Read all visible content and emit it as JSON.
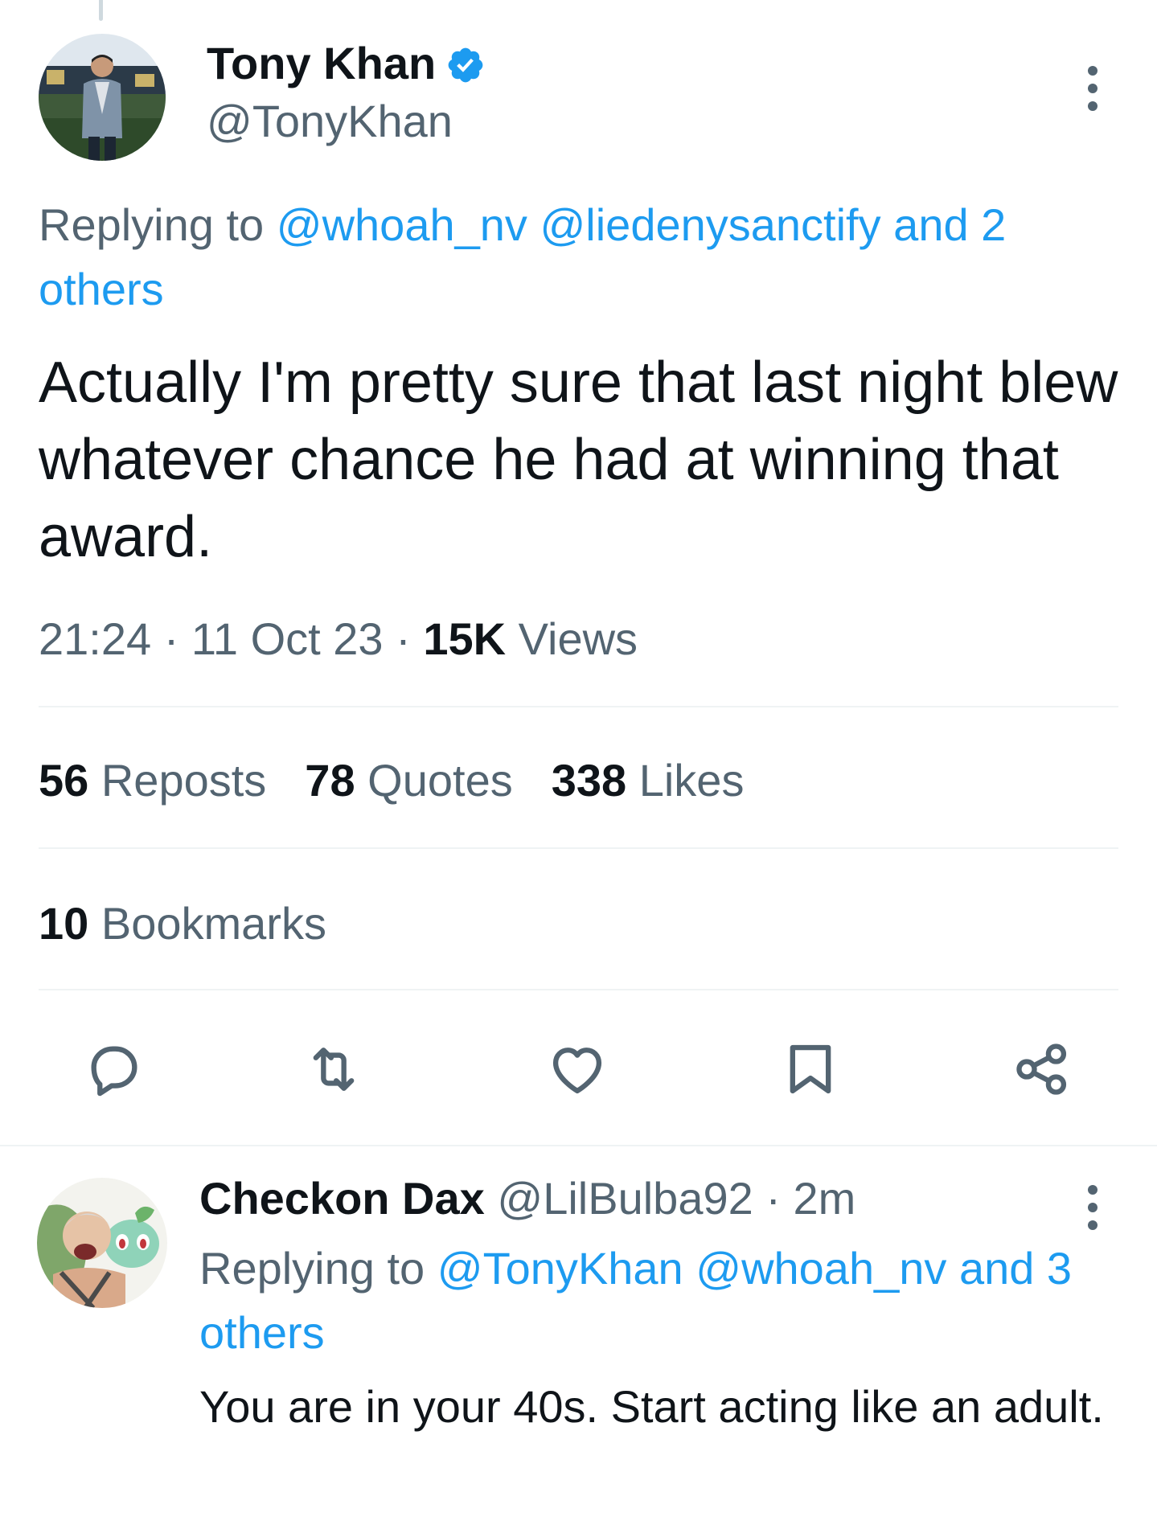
{
  "main_tweet": {
    "author_name": "Tony Khan",
    "author_handle": "@TonyKhan",
    "replying_prefix": "Replying to ",
    "replying_mention_1": "@whoah_nv",
    "replying_mention_2": "@liedenysanctify",
    "replying_others": "and 2 others",
    "text": "Actually I'm pretty sure that last night blew whatever chance he had at winning that award.",
    "time": "21:24",
    "date": "11 Oct 23",
    "separator": "·",
    "views_count": "15K",
    "views_label": "Views",
    "reposts_count": "56",
    "reposts_label": "Reposts",
    "quotes_count": "78",
    "quotes_label": "Quotes",
    "likes_count": "338",
    "likes_label": "Likes",
    "bookmarks_count": "10",
    "bookmarks_label": "Bookmarks"
  },
  "actions": {
    "icons": [
      "comment-icon",
      "retweet-icon",
      "heart-icon",
      "bookmark-icon",
      "share-icon"
    ]
  },
  "reply_tweet": {
    "author_name": "Checkon Dax",
    "author_handle": "@LilBulba92",
    "separator": "·",
    "time_ago": "2m",
    "replying_prefix": "Replying to ",
    "replying_mention_1": "@TonyKhan",
    "replying_mention_2": "@whoah_nv",
    "replying_others": "and 3 others",
    "text": "You are in your 40s. Start acting like an adult."
  },
  "colors": {
    "accent": "#1d9bf0",
    "secondary_text": "#536471",
    "primary_text": "#0f1419",
    "divider": "#eff3f4"
  }
}
